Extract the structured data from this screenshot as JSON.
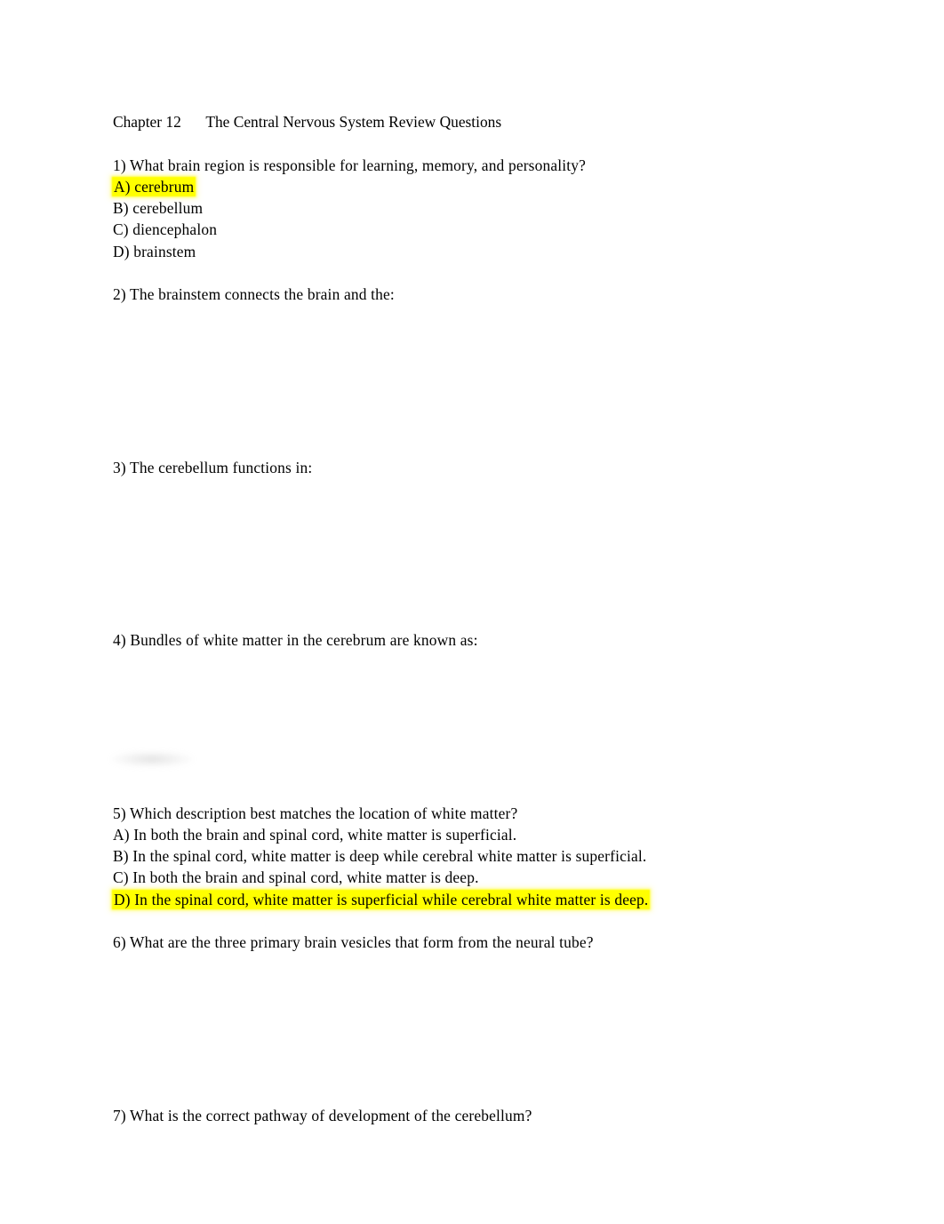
{
  "document": {
    "title": "Chapter 12\tThe Central Nervous System Review Questions",
    "page_background": "#ffffff",
    "text_color": "#000000",
    "highlight_color": "#ffff00"
  },
  "questions": {
    "q1": {
      "prompt": "1) What brain region is responsible for learning, memory, and personality?",
      "options": [
        {
          "label": "A) cerebrum",
          "highlighted": true
        },
        {
          "label": "B) cerebellum",
          "highlighted": false
        },
        {
          "label": "C) diencephalon",
          "highlighted": false
        },
        {
          "label": "D) brainstem",
          "highlighted": false
        }
      ]
    },
    "q2": {
      "prompt": "2) The brainstem connects the brain and the:"
    },
    "q3": {
      "prompt": "3) The cerebellum functions in:"
    },
    "q4": {
      "prompt": "4) Bundles of white matter in the cerebrum are known as:"
    },
    "q5": {
      "prompt": "5) Which description best matches the location of white matter?",
      "options": [
        {
          "label": "A) In both the brain and spinal cord, white matter is superficial.",
          "highlighted": false
        },
        {
          "label": "B) In the spinal cord, white matter is deep while cerebral white matter is superficial.",
          "highlighted": false
        },
        {
          "label": "C) In both the brain and spinal cord, white matter is deep.",
          "highlighted": false
        },
        {
          "label": "D) In the spinal cord, white matter is superficial while cerebral white matter is deep.",
          "highlighted": true
        }
      ]
    },
    "q6": {
      "prompt": "6) What are the three primary brain vesicles that form from the neural tube?"
    },
    "q7": {
      "prompt": "7) What is the correct pathway of development of the cerebellum?"
    }
  }
}
